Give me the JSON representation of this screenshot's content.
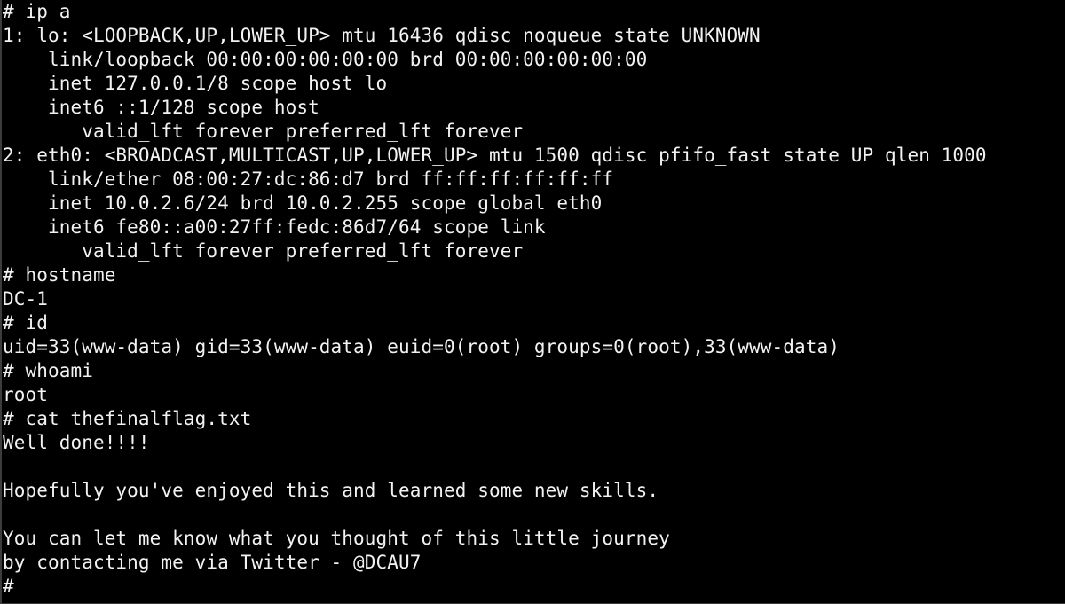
{
  "terminal": {
    "prompt": "#",
    "lines": [
      {
        "type": "command",
        "text": "# ip a"
      },
      {
        "type": "output",
        "text": "1: lo: <LOOPBACK,UP,LOWER_UP> mtu 16436 qdisc noqueue state UNKNOWN"
      },
      {
        "type": "output",
        "text": "    link/loopback 00:00:00:00:00:00 brd 00:00:00:00:00:00"
      },
      {
        "type": "output",
        "text": "    inet 127.0.0.1/8 scope host lo"
      },
      {
        "type": "output",
        "text": "    inet6 ::1/128 scope host"
      },
      {
        "type": "output",
        "text": "       valid_lft forever preferred_lft forever"
      },
      {
        "type": "output",
        "text": "2: eth0: <BROADCAST,MULTICAST,UP,LOWER_UP> mtu 1500 qdisc pfifo_fast state UP qlen 1000"
      },
      {
        "type": "output",
        "text": "    link/ether 08:00:27:dc:86:d7 brd ff:ff:ff:ff:ff:ff"
      },
      {
        "type": "output",
        "text": "    inet 10.0.2.6/24 brd 10.0.2.255 scope global eth0"
      },
      {
        "type": "output",
        "text": "    inet6 fe80::a00:27ff:fedc:86d7/64 scope link"
      },
      {
        "type": "output",
        "text": "       valid_lft forever preferred_lft forever"
      },
      {
        "type": "command",
        "text": "# hostname"
      },
      {
        "type": "output",
        "text": "DC-1"
      },
      {
        "type": "command",
        "text": "# id"
      },
      {
        "type": "output",
        "text": "uid=33(www-data) gid=33(www-data) euid=0(root) groups=0(root),33(www-data)"
      },
      {
        "type": "command",
        "text": "# whoami"
      },
      {
        "type": "output",
        "text": "root"
      },
      {
        "type": "command",
        "text": "# cat thefinalflag.txt"
      },
      {
        "type": "output",
        "text": "Well done!!!!"
      },
      {
        "type": "output",
        "text": ""
      },
      {
        "type": "output",
        "text": "Hopefully you've enjoyed this and learned some new skills."
      },
      {
        "type": "output",
        "text": ""
      },
      {
        "type": "output",
        "text": "You can let me know what you thought of this little journey"
      },
      {
        "type": "output",
        "text": "by contacting me via Twitter - @DCAU7"
      },
      {
        "type": "prompt",
        "text": "#"
      }
    ]
  },
  "colors": {
    "background": "#000000",
    "foreground": "#f2f2f2"
  }
}
